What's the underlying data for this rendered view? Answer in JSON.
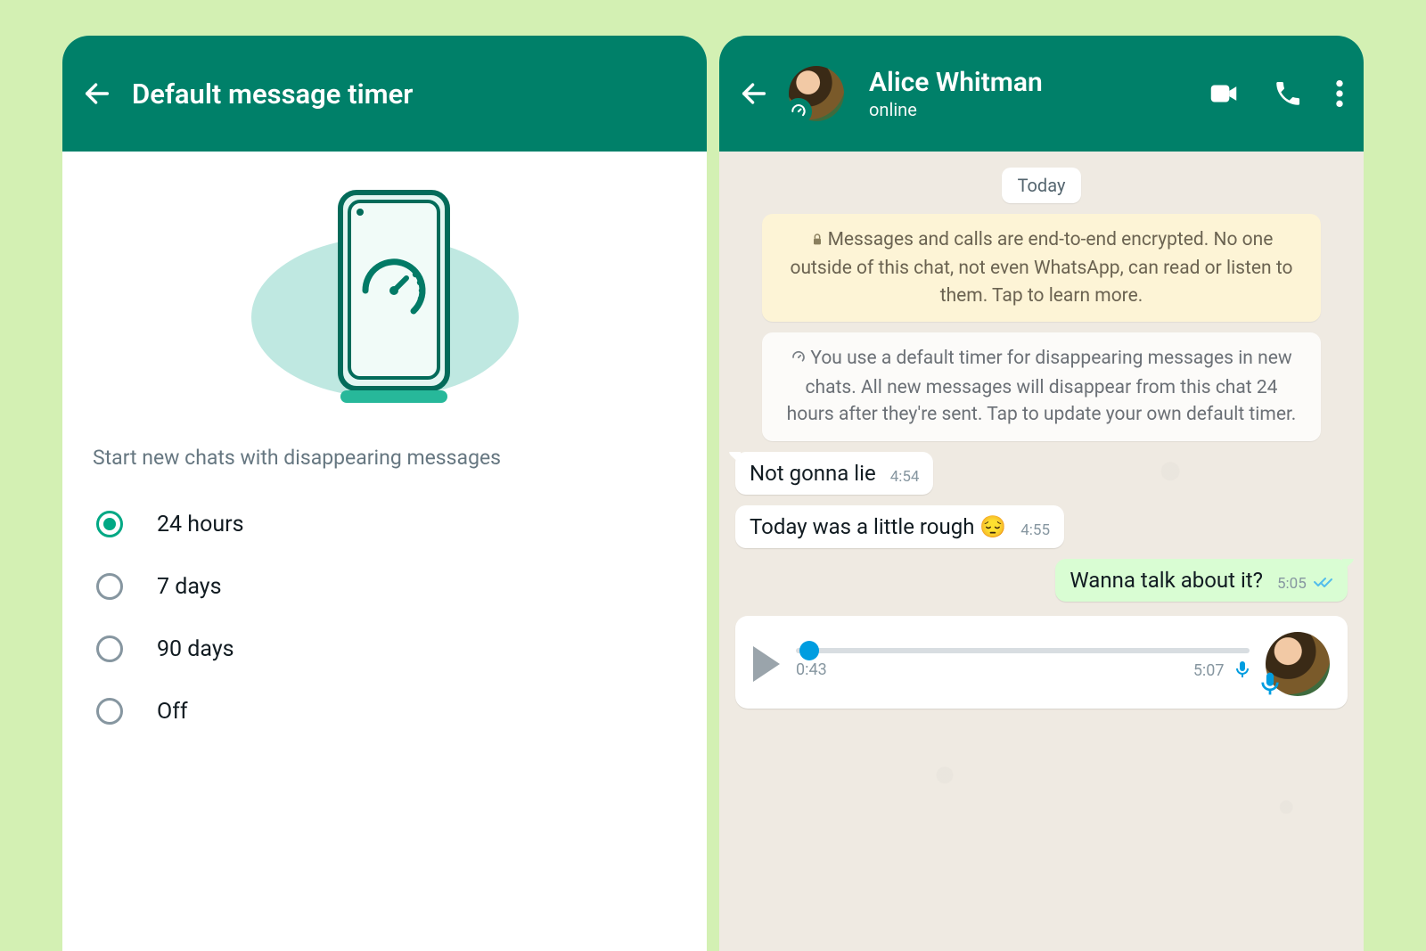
{
  "colors": {
    "brand": "#008069",
    "accent": "#00a884",
    "tick": "#53bdeb",
    "playhead": "#009de0"
  },
  "left": {
    "title": "Default message timer",
    "sectionLabel": "Start new chats with disappearing messages",
    "options": [
      {
        "label": "24 hours",
        "checked": true
      },
      {
        "label": "7 days",
        "checked": false
      },
      {
        "label": "90 days",
        "checked": false
      },
      {
        "label": "Off",
        "checked": false
      }
    ]
  },
  "right": {
    "contactName": "Alice Whitman",
    "contactStatus": "online",
    "dateChip": "Today",
    "encryptionNotice": "Messages and calls are end-to-end encrypted. No one outside of this chat, not even WhatsApp, can read or listen to them. Tap to learn more.",
    "timerNotice": "You use a default timer for disappearing messages in new chats. All new messages will disappear from this chat 24 hours after they're sent. Tap to update your own default timer.",
    "messages": [
      {
        "dir": "in",
        "text": "Not gonna lie",
        "time": "4:54"
      },
      {
        "dir": "in",
        "text": "Today was a little rough 😔",
        "time": "4:55"
      },
      {
        "dir": "out",
        "text": "Wanna talk about it?",
        "time": "5:05",
        "read": true
      }
    ],
    "voice": {
      "elapsed": "0:43",
      "total": "5:07"
    }
  }
}
